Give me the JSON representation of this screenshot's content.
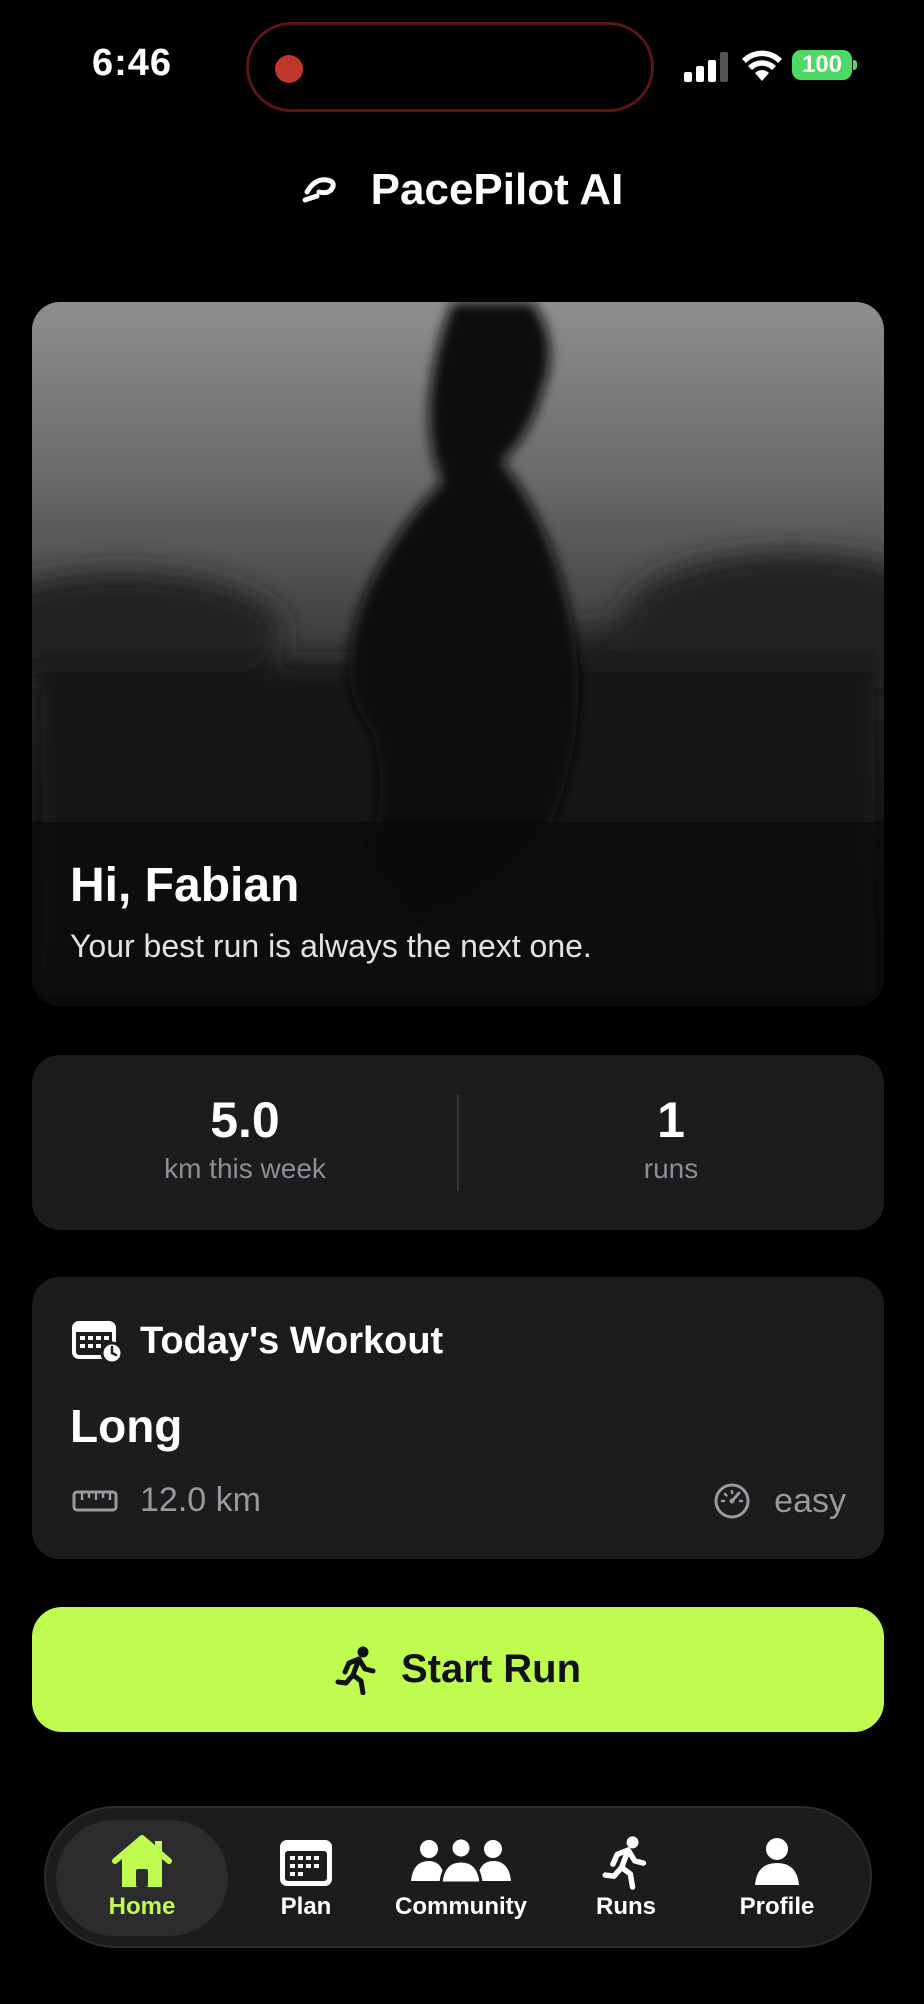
{
  "status": {
    "time": "6:46",
    "battery": "100"
  },
  "app": {
    "title": "PacePilot AI"
  },
  "hero": {
    "greeting": "Hi, Fabian",
    "tagline": "Your best run is always the next one."
  },
  "stats": [
    {
      "value": "5.0",
      "label": "km this week"
    },
    {
      "value": "1",
      "label": "runs"
    }
  ],
  "workout": {
    "heading": "Today's Workout",
    "name": "Long",
    "distance": "12.0 km",
    "intensity": "easy"
  },
  "actions": {
    "start_run": "Start Run"
  },
  "tabs": [
    {
      "label": "Home",
      "icon": "house-icon",
      "active": true
    },
    {
      "label": "Plan",
      "icon": "calendar-icon",
      "active": false
    },
    {
      "label": "Community",
      "icon": "people-icon",
      "active": false
    },
    {
      "label": "Runs",
      "icon": "runner-icon",
      "active": false
    },
    {
      "label": "Profile",
      "icon": "person-icon",
      "active": false
    }
  ],
  "colors": {
    "accent": "#c0fb50",
    "card": "#1c1c1e",
    "background": "#000000",
    "battery": "#4cd964"
  }
}
